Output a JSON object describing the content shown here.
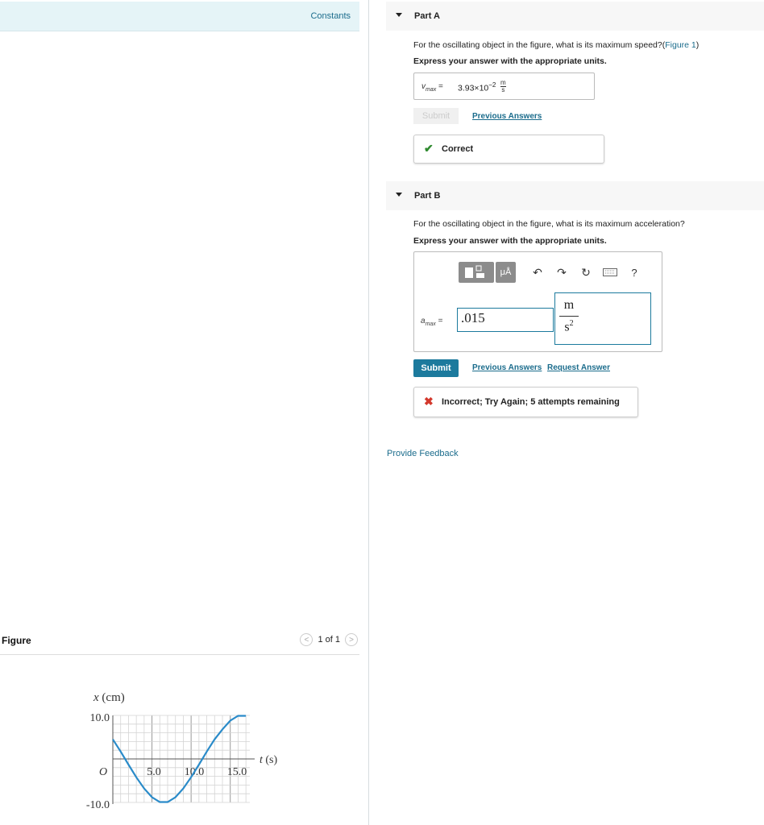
{
  "constants_label": "Constants",
  "figure": {
    "title": "Figure",
    "pager": "1 of 1",
    "prev_icon": "chevron-left-icon",
    "next_icon": "chevron-right-icon"
  },
  "chart_data": {
    "type": "line",
    "xlabel": "t (s)",
    "ylabel": "x (cm)",
    "origin_label": "O",
    "x_tick_labels": [
      "5.0",
      "10.0",
      "15.0"
    ],
    "y_tick_labels": [
      "10.0",
      "-10.0"
    ],
    "xlim": [
      0,
      17.5
    ],
    "ylim": [
      -10,
      10
    ],
    "grid": true,
    "series": [
      {
        "x": [
          0,
          1,
          2,
          3,
          4,
          5,
          6,
          7,
          8,
          9,
          10,
          11,
          12,
          13,
          14,
          15,
          16,
          17
        ],
        "y": [
          4.5,
          1.7,
          -1.3,
          -4.2,
          -6.8,
          -8.8,
          -9.9,
          -9.9,
          -8.8,
          -6.8,
          -4.2,
          -1.3,
          1.7,
          4.5,
          6.8,
          8.8,
          9.9,
          9.9
        ]
      }
    ]
  },
  "partA": {
    "label": "Part A",
    "question": "For the oscillating object in the figure, what is its maximum speed?(",
    "figure_link": "Figure 1",
    "question_end": ")",
    "instruction": "Express your answer with the appropriate units.",
    "variable": "v",
    "variable_sub": "max",
    "equals": "=",
    "value_mantissa": "3.93×10",
    "value_exponent": "−2",
    "unit_num": "m",
    "unit_den": "s",
    "submit_label": "Submit",
    "previous_answers": "Previous Answers",
    "feedback": "Correct",
    "feedback_icon": "checkmark-icon",
    "feedback_color": "#2f8a2f"
  },
  "partB": {
    "label": "Part B",
    "question": "For the oscillating object in the figure, what is its maximum acceleration?",
    "instruction": "Express your answer with the appropriate units.",
    "variable": "a",
    "variable_sub": "max",
    "equals": "=",
    "input_value": ".015",
    "unit_num": "m",
    "unit_den": "s",
    "unit_den_exp": "2",
    "toolbar": {
      "units_label": "μÅ",
      "undo_icon": "undo-icon",
      "redo_icon": "redo-icon",
      "reset_icon": "reset-icon",
      "keyboard_icon": "keyboard-icon",
      "help_label": "?"
    },
    "submit_label": "Submit",
    "previous_answers": "Previous Answers",
    "request_answer": "Request Answer",
    "feedback": "Incorrect; Try Again; 5 attempts remaining",
    "feedback_icon": "x-icon",
    "feedback_color": "#d3382c"
  },
  "provide_feedback": "Provide Feedback",
  "colors": {
    "accent": "#1c7a9d",
    "graph_line": "#2a8bc9"
  }
}
